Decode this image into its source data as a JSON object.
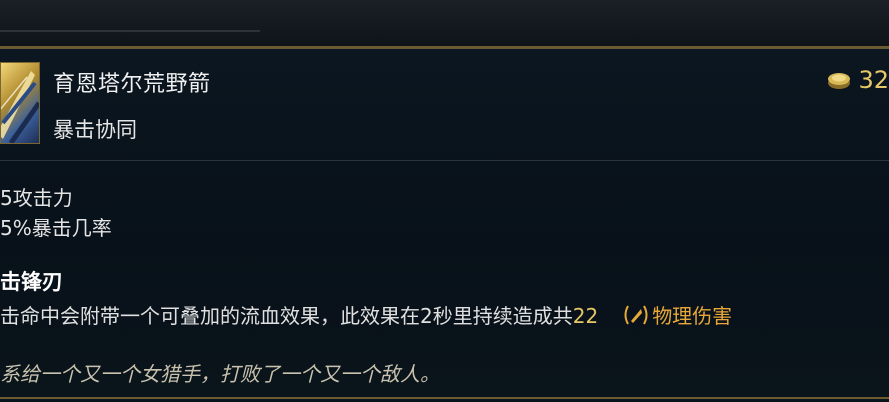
{
  "item": {
    "name": "育恩塔尔荒野箭",
    "tag": "暴击协同",
    "price": "32",
    "icon": "item-arrow-icon",
    "price_icon": "gold-coin-icon"
  },
  "stats": [
    "5攻击力",
    "5%暴击几率"
  ],
  "passive": {
    "title": "击锋刃",
    "desc_prefix": "击命中会附带一个可叠加的流血效果，此效果在2秒里持续造成共",
    "damage_value": "22",
    "damage_type": "物理伤害",
    "damage_icon": "physical-damage-icon"
  },
  "lore": "系给一个又一个女猎手，打败了一个又一个敌人。",
  "colors": {
    "gold": "#e7c766",
    "physical": "#e7a83a",
    "border": "#6e5a2f"
  }
}
